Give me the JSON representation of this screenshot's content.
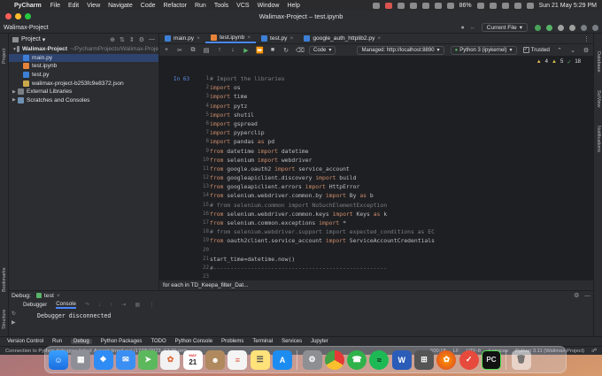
{
  "menubar": {
    "app": "PyCharm",
    "items": [
      "File",
      "Edit",
      "View",
      "Navigate",
      "Code",
      "Refactor",
      "Run",
      "Tools",
      "VCS",
      "Window",
      "Help"
    ],
    "battery": "86%",
    "datetime": "Sun 21 May 5:29 PM"
  },
  "window": {
    "title": "Walimax-Project – test.ipynb",
    "breadcrumb": "Walimax-Project",
    "current_file": "Current File"
  },
  "project": {
    "header": "Project",
    "root": "Walimax-Project",
    "root_path": "~/PycharmProjects/Walimax-Proje",
    "files": [
      "main.py",
      "test.ipynb",
      "test.py",
      "walimax-project-b253fc9e8372.json"
    ],
    "external": "External Libraries",
    "scratches": "Scratches and Consoles"
  },
  "tabs": [
    "main.py",
    "test.ipynb",
    "test.py",
    "google_auth_httplib2.py"
  ],
  "toolbar": {
    "cell_type": "Code",
    "server": "Managed: http://localhost:8890",
    "kernel": "Python 3 (ipykernel)",
    "trusted": "Trusted"
  },
  "editor": {
    "cell_label": "In 63",
    "indicators": {
      "warnings": "4",
      "weak": "5",
      "typos": "18"
    },
    "line_numbers": [
      "1",
      "2",
      "3",
      "4",
      "5",
      "6",
      "7",
      "8",
      "9",
      "10",
      "11",
      "12",
      "13",
      "14",
      "15",
      "16",
      "17",
      "18",
      "19",
      "20",
      "21",
      "22",
      "23"
    ],
    "lines": [
      [
        {
          "t": "# Import the libraries",
          "c": "cm"
        }
      ],
      [
        {
          "t": "import ",
          "c": "kw"
        },
        {
          "t": "os",
          "c": ""
        }
      ],
      [
        {
          "t": "import ",
          "c": "kw"
        },
        {
          "t": "time",
          "c": ""
        }
      ],
      [
        {
          "t": "import ",
          "c": "kw"
        },
        {
          "t": "pytz",
          "c": ""
        }
      ],
      [
        {
          "t": "import ",
          "c": "kw"
        },
        {
          "t": "shutil",
          "c": ""
        }
      ],
      [
        {
          "t": "import ",
          "c": "kw"
        },
        {
          "t": "gspread",
          "c": ""
        }
      ],
      [
        {
          "t": "import ",
          "c": "kw"
        },
        {
          "t": "pyperclip",
          "c": ""
        }
      ],
      [
        {
          "t": "import ",
          "c": "kw"
        },
        {
          "t": "pandas ",
          "c": ""
        },
        {
          "t": "as ",
          "c": "kw"
        },
        {
          "t": "pd",
          "c": ""
        }
      ],
      [
        {
          "t": "from ",
          "c": "kw"
        },
        {
          "t": "datetime ",
          "c": ""
        },
        {
          "t": "import ",
          "c": "kw"
        },
        {
          "t": "datetime",
          "c": ""
        }
      ],
      [
        {
          "t": "from ",
          "c": "kw"
        },
        {
          "t": "selenium ",
          "c": ""
        },
        {
          "t": "import ",
          "c": "kw"
        },
        {
          "t": "webdriver",
          "c": ""
        }
      ],
      [
        {
          "t": "from ",
          "c": "kw"
        },
        {
          "t": "google.oauth2 ",
          "c": ""
        },
        {
          "t": "import ",
          "c": "kw"
        },
        {
          "t": "service_account",
          "c": ""
        }
      ],
      [
        {
          "t": "from ",
          "c": "kw"
        },
        {
          "t": "googleapiclient.discovery ",
          "c": ""
        },
        {
          "t": "import ",
          "c": "kw"
        },
        {
          "t": "build",
          "c": ""
        }
      ],
      [
        {
          "t": "from ",
          "c": "kw"
        },
        {
          "t": "googleapiclient.errors ",
          "c": ""
        },
        {
          "t": "import ",
          "c": "kw"
        },
        {
          "t": "HttpError",
          "c": ""
        }
      ],
      [
        {
          "t": "from ",
          "c": "kw"
        },
        {
          "t": "selenium.webdriver.common.by ",
          "c": ""
        },
        {
          "t": "import ",
          "c": "kw"
        },
        {
          "t": "By ",
          "c": ""
        },
        {
          "t": "as ",
          "c": "kw"
        },
        {
          "t": "b",
          "c": ""
        }
      ],
      [
        {
          "t": "# from selenium.common import NoSuchElementException",
          "c": "cm"
        }
      ],
      [
        {
          "t": "from ",
          "c": "kw"
        },
        {
          "t": "selenium.webdriver.common.keys ",
          "c": ""
        },
        {
          "t": "import ",
          "c": "kw"
        },
        {
          "t": "Keys ",
          "c": ""
        },
        {
          "t": "as ",
          "c": "kw"
        },
        {
          "t": "k",
          "c": ""
        }
      ],
      [
        {
          "t": "from ",
          "c": "kw"
        },
        {
          "t": "selenium.common.exceptions ",
          "c": ""
        },
        {
          "t": "import ",
          "c": "kw"
        },
        {
          "t": "*",
          "c": ""
        }
      ],
      [
        {
          "t": "# from selenium.webdriver.support import expected_conditions as EC",
          "c": "cm"
        }
      ],
      [
        {
          "t": "from ",
          "c": "kw"
        },
        {
          "t": "oauth2client.service_account ",
          "c": ""
        },
        {
          "t": "import ",
          "c": "kw"
        },
        {
          "t": "ServiceAccountCredentials",
          "c": ""
        }
      ],
      [
        {
          "t": "",
          "c": ""
        }
      ],
      [
        {
          "t": "start_time=datetime.now()",
          "c": ""
        }
      ],
      [
        {
          "t": "#---------------------------------------------------",
          "c": "cm"
        }
      ],
      [
        {
          "t": "",
          "c": ""
        }
      ]
    ],
    "breadcrumb": "for each in TD_Keepa_filter_Dat..."
  },
  "debug": {
    "label": "Debug:",
    "session": "test",
    "tabs": [
      "Debugger",
      "Console"
    ],
    "output": "Debugger disconnected"
  },
  "bottombar": [
    "Version Control",
    "Run",
    "Debug",
    "Python Packages",
    "TODO",
    "Python Console",
    "Problems",
    "Terminal",
    "Services",
    "Jupyter"
  ],
  "status": {
    "message": "Connection to Python debugger failed: Accept timed out (17/05/2023, 12:20 pm)",
    "position": "600:18",
    "line_sep": "LF",
    "encoding": "UTF-8",
    "indent": "4 spaces",
    "interpreter": "Python 3.11 (Walimax-Project)"
  },
  "right_stripe": [
    "Database",
    "SciView",
    "Notifications"
  ],
  "left_stripe": [
    "Project",
    "Bookmarks",
    "Structure"
  ],
  "dock_icons": [
    "finder-icon",
    "launchpad-icon",
    "safari-icon",
    "mail-icon",
    "maps-icon",
    "photos-icon",
    "calendar-icon",
    "contacts-icon",
    "reminders-icon",
    "notes-icon",
    "appstore-icon",
    "settings-icon",
    "chrome-icon",
    "whatsapp-icon",
    "spotify-icon",
    "word-icon",
    "calculator-icon",
    "firefox-icon",
    "todo-icon",
    "pycharm-icon",
    "trash-icon"
  ],
  "dock": {
    "calendar_month": "MAY",
    "calendar_day": "21"
  },
  "colors": {
    "accent": "#4a88ff",
    "keyword": "#cf8e6d",
    "comment": "#7a7e85",
    "editor_bg": "#1e1f22"
  }
}
